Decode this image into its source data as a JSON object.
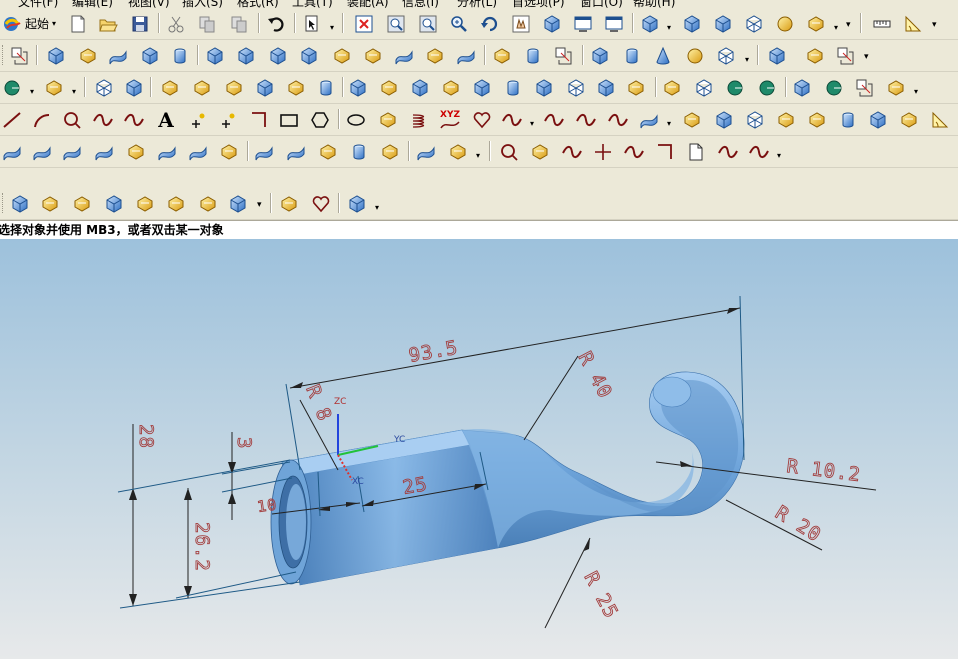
{
  "menu": {
    "items": [
      "文件(F)",
      "编辑(E)",
      "视图(V)",
      "插入(S)",
      "格式(R)",
      "工具(T)",
      "装配(A)",
      "信息(I)",
      "分析(L)",
      "首选项(P)",
      "窗口(O)",
      "帮助(H)"
    ]
  },
  "toolbar": {
    "start_label": "起始",
    "text_tool": "A",
    "xyz_label": "XYZ"
  },
  "status": {
    "prompt": "选择对象并使用 MB3，或者双击某一对象"
  },
  "model": {
    "body_color": "#6ea4da",
    "dimensions": {
      "overall_length": "93.5",
      "r8": "R 8",
      "r40": "R 40",
      "r10_2": "R 10.2",
      "r20": "R 20",
      "r25": "R 25",
      "len25": "25",
      "h28": "28",
      "h3": "3",
      "d26_2": "26.2",
      "d10": "10"
    },
    "axes": {
      "zc": "ZC",
      "yc": "YC",
      "xc": "XC"
    }
  },
  "colors": {
    "dimension_text": "#a33e3e",
    "extension_line": "#1f5a86",
    "axis_x": "#e0302a",
    "axis_y": "#22c23a",
    "axis_z": "#2244dd"
  }
}
